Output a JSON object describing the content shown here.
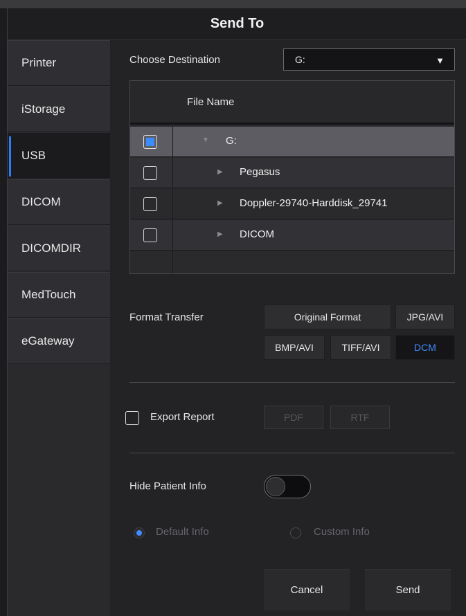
{
  "dialog": {
    "title": "Send To"
  },
  "sidebar": {
    "items": [
      {
        "label": "Printer"
      },
      {
        "label": "iStorage"
      },
      {
        "label": "USB",
        "active": true
      },
      {
        "label": "DICOM"
      },
      {
        "label": "DICOMDIR"
      },
      {
        "label": "MedTouch"
      },
      {
        "label": "eGateway"
      }
    ]
  },
  "destination": {
    "label": "Choose Destination",
    "value": "G:"
  },
  "file_tree": {
    "header": "File Name",
    "rows": [
      {
        "name": "G:",
        "checked": true,
        "expanded": true
      },
      {
        "name": "Pegasus",
        "checked": false
      },
      {
        "name": "Doppler-29740-Harddisk_29741",
        "checked": false
      },
      {
        "name": "DICOM",
        "checked": false
      }
    ]
  },
  "format_transfer": {
    "label": "Format Transfer",
    "options": [
      {
        "label": "Original Format"
      },
      {
        "label": "JPG/AVI"
      },
      {
        "label": "BMP/AVI"
      },
      {
        "label": "TIFF/AVI"
      },
      {
        "label": "DCM",
        "selected": true
      }
    ]
  },
  "export_report": {
    "label": "Export Report",
    "checked": false,
    "formats": [
      {
        "label": "PDF"
      },
      {
        "label": "RTF"
      }
    ]
  },
  "hide_patient_info": {
    "label": "Hide Patient Info",
    "enabled": false,
    "options": [
      {
        "label": "Default Info",
        "selected": true
      },
      {
        "label": "Custom Info",
        "selected": false
      }
    ]
  },
  "actions": {
    "cancel": "Cancel",
    "send": "Send"
  },
  "colors": {
    "accent": "#3f8cff",
    "background": "#232326"
  }
}
